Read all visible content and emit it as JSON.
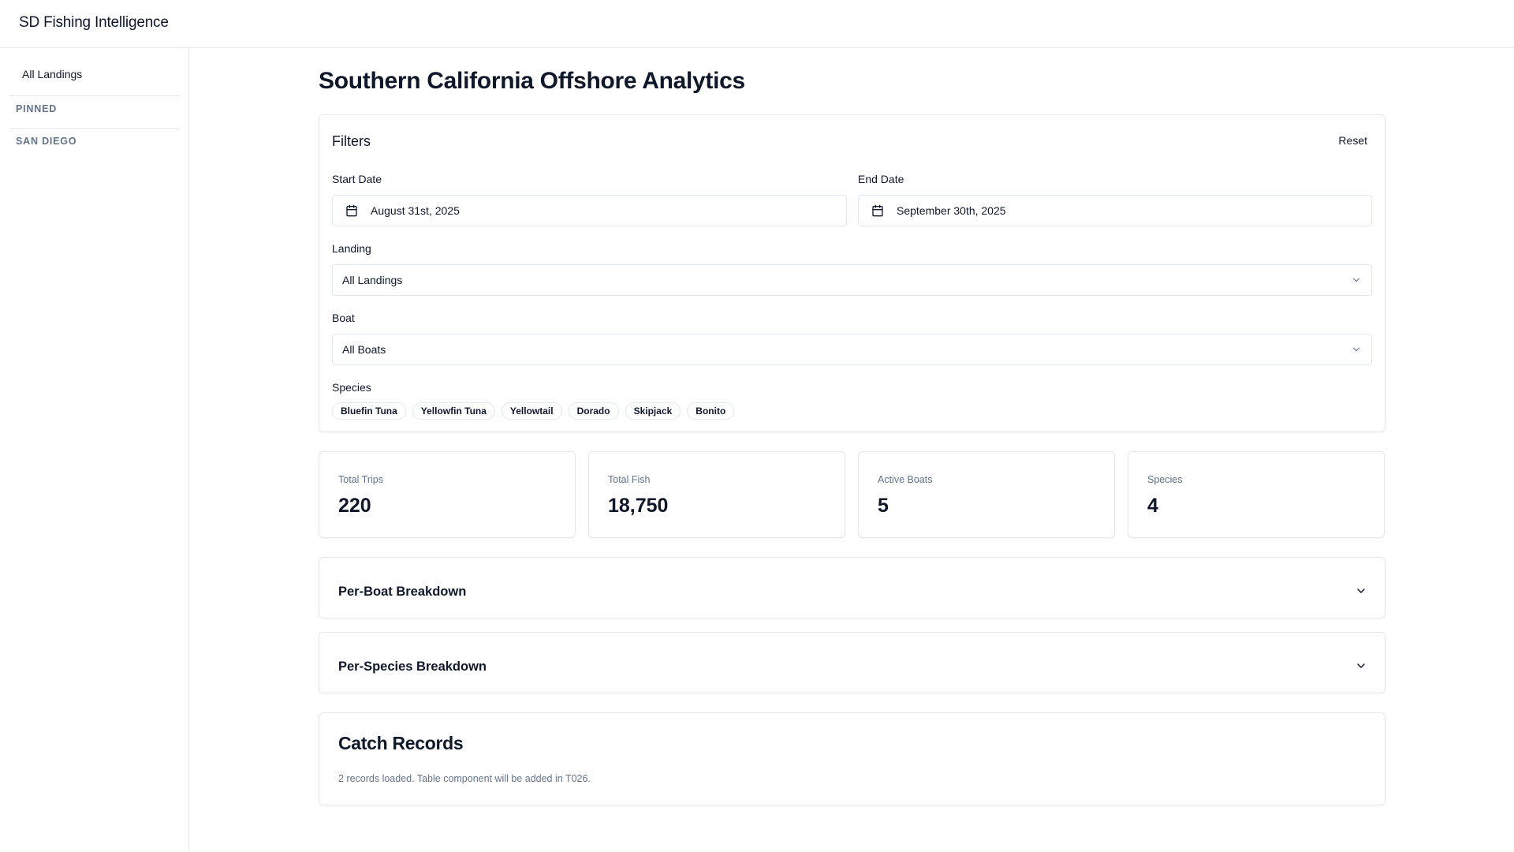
{
  "app": {
    "title": "SD Fishing Intelligence"
  },
  "sidebar": {
    "items": [
      {
        "label": "All Landings"
      }
    ],
    "sections": [
      {
        "label": "PINNED"
      },
      {
        "label": "SAN DIEGO"
      }
    ]
  },
  "page": {
    "title": "Southern California Offshore Analytics"
  },
  "filters": {
    "title": "Filters",
    "reset_label": "Reset",
    "start_date": {
      "label": "Start Date",
      "value": "August 31st, 2025"
    },
    "end_date": {
      "label": "End Date",
      "value": "September 30th, 2025"
    },
    "landing": {
      "label": "Landing",
      "value": "All Landings"
    },
    "boat": {
      "label": "Boat",
      "value": "All Boats"
    },
    "species": {
      "label": "Species",
      "options": [
        "Bluefin Tuna",
        "Yellowfin Tuna",
        "Yellowtail",
        "Dorado",
        "Skipjack",
        "Bonito"
      ]
    }
  },
  "stats": [
    {
      "label": "Total Trips",
      "value": "220"
    },
    {
      "label": "Total Fish",
      "value": "18,750"
    },
    {
      "label": "Active Boats",
      "value": "5"
    },
    {
      "label": "Species",
      "value": "4"
    }
  ],
  "breakdowns": [
    {
      "title": "Per-Boat Breakdown"
    },
    {
      "title": "Per-Species Breakdown"
    }
  ],
  "catch_records": {
    "title": "Catch Records",
    "message": "2 records loaded. Table component will be added in T026."
  },
  "icons": {
    "calendar": "calendar-icon",
    "chevron": "chevron-down-icon"
  }
}
